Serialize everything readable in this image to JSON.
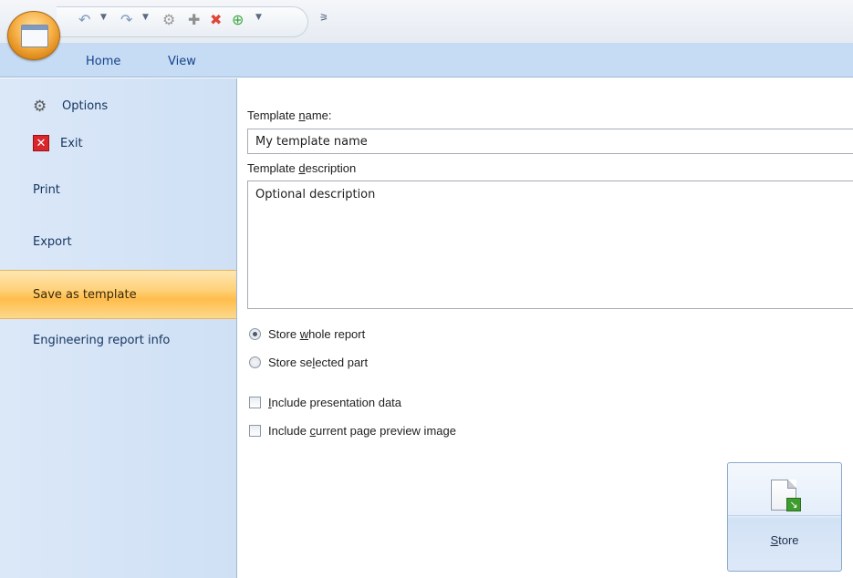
{
  "quick_access": {
    "buttons": [
      {
        "name": "undo-icon",
        "glyph": "↶"
      },
      {
        "name": "redo-icon",
        "glyph": "↷"
      },
      {
        "name": "settings-icon",
        "glyph": "⚙"
      },
      {
        "name": "add-icon",
        "glyph": "✚"
      },
      {
        "name": "delete-icon",
        "glyph": "✖"
      },
      {
        "name": "refresh-icon",
        "glyph": "⊕"
      }
    ],
    "customize_glyph": "₹"
  },
  "tabs": [
    {
      "label": "Home"
    },
    {
      "label": "View"
    }
  ],
  "menu": {
    "options_label": "Options",
    "exit_label": "Exit",
    "print_label": "Print",
    "export_label": "Export",
    "save_template_label": "Save as template",
    "eng_info_label": "Engineering report info"
  },
  "form": {
    "name_label_pre": "Template ",
    "name_label_key": "n",
    "name_label_post": "ame:",
    "name_value": "My template name",
    "desc_label_pre": "Template ",
    "desc_label_key": "d",
    "desc_label_post": "escription",
    "desc_value": "Optional description",
    "store_whole_pre": "Store ",
    "store_whole_key": "w",
    "store_whole_post": "hole report",
    "store_selected_pre": "Store se",
    "store_selected_key": "l",
    "store_selected_post": "ected part",
    "include_pres_key": "I",
    "include_pres_post": "nclude presentation data",
    "include_preview_pre": "Include ",
    "include_preview_key": "c",
    "include_preview_post": "urrent page preview image"
  },
  "store_button": {
    "label_key": "S",
    "label_post": "tore"
  },
  "colors": {
    "accent": "#15428b",
    "selected_menu": "#ffbd4c",
    "menu_bg": "#dbe8f8"
  }
}
